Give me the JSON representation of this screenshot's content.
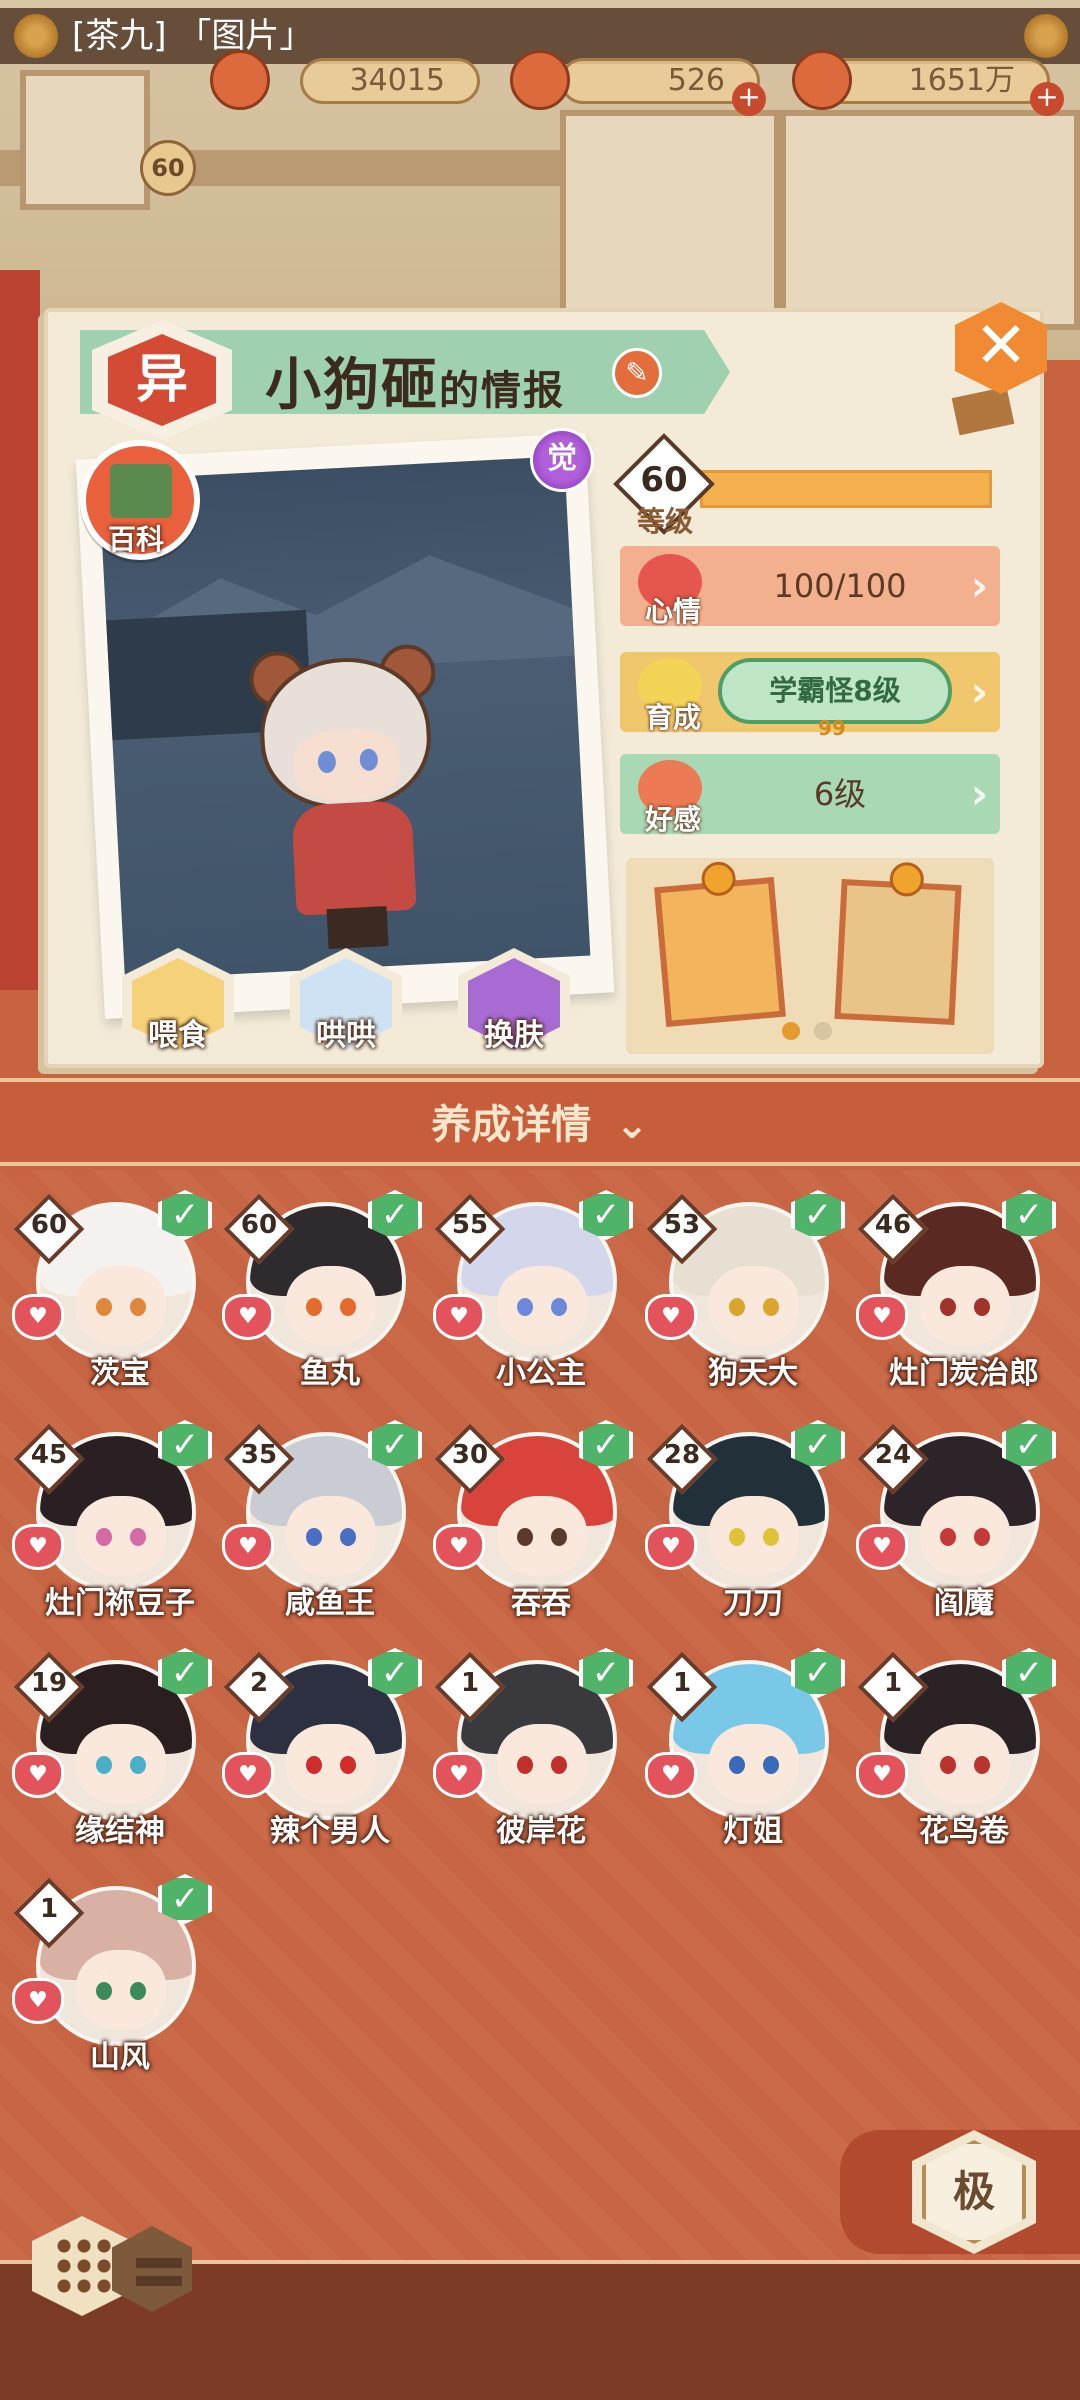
{
  "chat": {
    "text": "[茶九] 「图片」"
  },
  "resources": {
    "jade": "34015",
    "stamina": "526",
    "coins": "1651万"
  },
  "player": {
    "level": "60"
  },
  "card": {
    "rarity_icon": "异",
    "title_name": "小狗砸",
    "title_suffix": "的情报",
    "awaken_badge": "觉",
    "wiki_label": "百科"
  },
  "stats": {
    "level_value": "60",
    "level_label": "等级",
    "mood_label": "心情",
    "mood_value": "100/100",
    "growth_label": "育成",
    "growth_value": "学霸怪8级",
    "growth_sub": "99",
    "affinity_label": "好感",
    "affinity_value": "6级"
  },
  "actions": [
    {
      "label": "喂食",
      "icon": "noodle-bowl-icon"
    },
    {
      "label": "哄哄",
      "icon": "milk-carton-icon"
    },
    {
      "label": "换肤",
      "icon": "kimono-icon"
    }
  ],
  "detail_section": {
    "label": "养成详情",
    "icon": "double-chevron-down-icon"
  },
  "shikigami": [
    {
      "level": "60",
      "name": "茨宝",
      "hair": "#f4f1ee",
      "eye": "#e0883a"
    },
    {
      "level": "60",
      "name": "鱼丸",
      "hair": "#2e2a2e",
      "eye": "#e46b2e"
    },
    {
      "level": "55",
      "name": "小公主",
      "hair": "#d4d6ec",
      "eye": "#6d88d8"
    },
    {
      "level": "53",
      "name": "狗天大",
      "hair": "#e7e0d2",
      "eye": "#d9a52c"
    },
    {
      "level": "46",
      "name": "灶门炭治郎",
      "hair": "#5a2a22",
      "eye": "#a0332c"
    },
    {
      "level": "45",
      "name": "灶门祢豆子",
      "hair": "#2a1f22",
      "eye": "#d46aa8"
    },
    {
      "level": "35",
      "name": "咸鱼王",
      "hair": "#c9ccd2",
      "eye": "#4a6ec0"
    },
    {
      "level": "30",
      "name": "吞吞",
      "hair": "#d8443b",
      "eye": "#5a3a2e"
    },
    {
      "level": "28",
      "name": "刀刀",
      "hair": "#22303a",
      "eye": "#e0c23a"
    },
    {
      "level": "24",
      "name": "阎魔",
      "hair": "#2c2428",
      "eye": "#c43a3a"
    },
    {
      "level": "19",
      "name": "缘结神",
      "hair": "#2a1e1e",
      "eye": "#4ab0c8"
    },
    {
      "level": "2",
      "name": "辣个男人",
      "hair": "#2c3040",
      "eye": "#d02c2c"
    },
    {
      "level": "1",
      "name": "彼岸花",
      "hair": "#3a3a3e",
      "eye": "#c0302c"
    },
    {
      "level": "1",
      "name": "灯姐",
      "hair": "#7ac8e8",
      "eye": "#3a6ab8"
    },
    {
      "level": "1",
      "name": "花鸟卷",
      "hair": "#2a2224",
      "eye": "#b8342c"
    },
    {
      "level": "1",
      "name": "山风",
      "hair": "#d8b0a4",
      "eye": "#3a8a5a"
    }
  ],
  "mode_button": {
    "label": "极"
  },
  "bottom": {
    "grid_view": "grid-view-icon",
    "list_view": "list-view-icon"
  },
  "colors": {
    "mood": "#f3b08f",
    "growth": "#f1c76d",
    "affinity": "#a8d8b4",
    "level_bar": "#f5b14f",
    "check": "#4fb36a"
  }
}
